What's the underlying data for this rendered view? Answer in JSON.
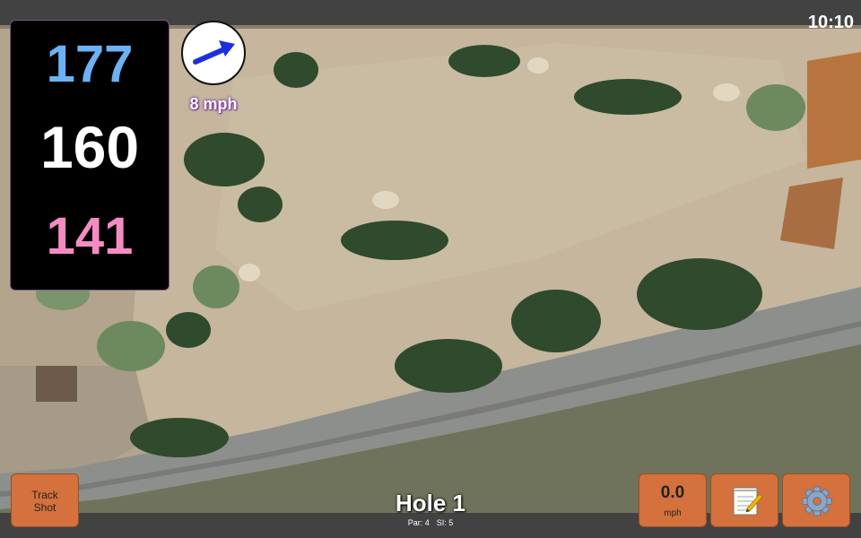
{
  "status": {
    "time": "10:10"
  },
  "yardages": {
    "back": "177",
    "middle": "160",
    "front": "141"
  },
  "wind": {
    "speed": "8 mph",
    "icon": "wind-arrow-icon"
  },
  "hole": {
    "title": "Hole 1",
    "par": "Par: 4",
    "stroke_index": "SI: 5"
  },
  "buttons": {
    "track_shot_line1": "Track",
    "track_shot_line2": "Shot",
    "speed_value": "0.0",
    "speed_unit": "mph",
    "notes_icon": "notepad-icon",
    "settings_icon": "gear-icon"
  },
  "colors": {
    "back_yardage": "#6cb2f4",
    "middle_yardage": "#ffffff",
    "front_yardage": "#f48cc4",
    "button": "#d4713d"
  }
}
